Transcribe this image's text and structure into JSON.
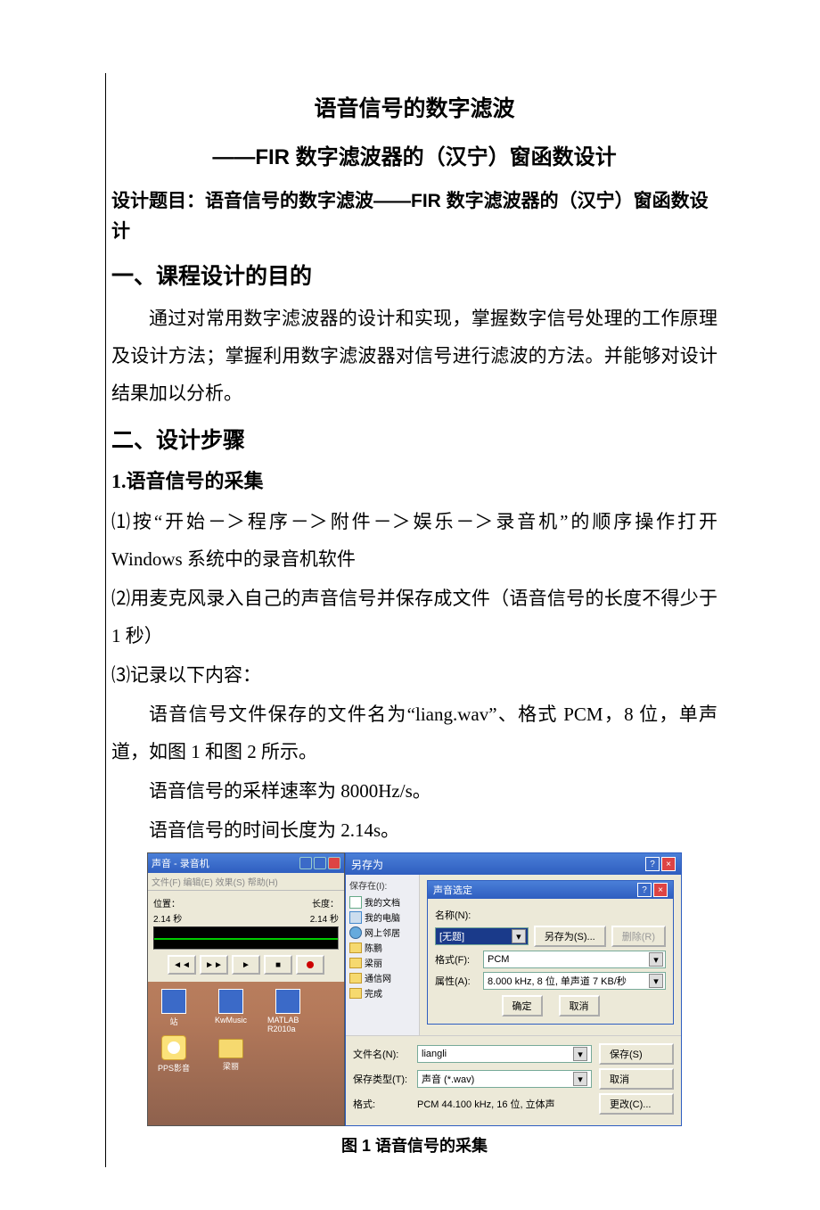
{
  "title_line1": "语音信号的数字滤波",
  "title_line2": "——FIR 数字滤波器的（汉宁）窗函数设计",
  "topic_line": "设计题目：语音信号的数字滤波——FIR 数字滤波器的（汉宁）窗函数设计",
  "section1_heading": "一、课程设计的目的",
  "section1_body": "通过对常用数字滤波器的设计和实现，掌握数字信号处理的工作原理及设计方法；掌握利用数字滤波器对信号进行滤波的方法。并能够对设计结果加以分析。",
  "section2_heading": "二、设计步骤",
  "section2_sub1": "1.语音信号的采集",
  "step1": "⑴按“开始－＞程序－＞附件－＞娱乐－＞录音机”的顺序操作打开 Windows 系统中的录音机软件",
  "step2": "⑵用麦克风录入自己的声音信号并保存成文件（语音信号的长度不得少于 1 秒）",
  "step3": "⑶记录以下内容：",
  "rec_line1": "语音信号文件保存的文件名为“liang.wav”、格式 PCM，8 位，单声道，如图 1 和图 2 所示。",
  "rec_line2": "语音信号的采样速率为 8000Hz/s。",
  "rec_line3": "语音信号的时间长度为 2.14s。",
  "figure1_caption": "图 1 语音信号的采集",
  "screenshot": {
    "recorder": {
      "title": "声音 - 录音机",
      "menu": "文件(F)  编辑(E)  效果(S)  帮助(H)",
      "pos_label": "位置：",
      "pos_value": "2.14 秒",
      "len_label": "长度：",
      "len_value": "2.14 秒"
    },
    "desk_icons": {
      "i1": "站",
      "i2": "KwMusic",
      "i3": "MATLAB R2010a",
      "i4": "PPS影音",
      "i5": "梁丽"
    },
    "saveas": {
      "title": "另存为",
      "help_q": "?",
      "left_label": "保存在(I):",
      "places": {
        "docs": "我的文档",
        "pc": "我的电脑",
        "net": "网上邻居",
        "f1": "陈鹏",
        "f2": "梁丽",
        "f3": "通信网",
        "f4": "完成"
      },
      "filename_label": "文件名(N):",
      "filename_value": "liangli",
      "type_label": "保存类型(T):",
      "type_value": "声音 (*.wav)",
      "format_label": "格式:",
      "format_value": "PCM 44.100 kHz, 16 位, 立体声",
      "save_btn": "保存(S)",
      "cancel_btn": "取消",
      "change_btn": "更改(C)..."
    },
    "sound_select": {
      "title": "声音选定",
      "name_label": "名称(N):",
      "name_value": "[无题]",
      "saveas_btn": "另存为(S)...",
      "delete_btn": "删除(R)",
      "format_label": "格式(F):",
      "format_value": "PCM",
      "attr_label": "属性(A):",
      "attr_value": "8.000 kHz, 8 位, 单声道     7 KB/秒",
      "ok_btn": "确定",
      "cancel_btn": "取消"
    }
  }
}
